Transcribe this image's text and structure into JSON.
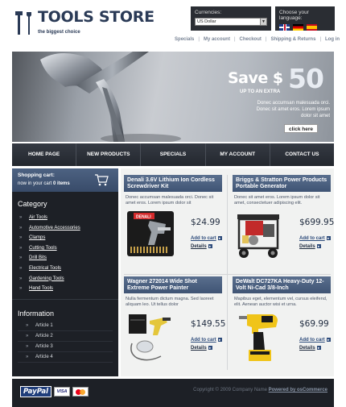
{
  "header": {
    "title": "TOOLS STORE",
    "subtitle": "the biggest choice",
    "currencies_label": "Currencies:",
    "currency_selected": "US Dollar",
    "language_label": "Choose your language:",
    "languages": [
      "English",
      "Deutsch",
      "Español"
    ],
    "toplinks": [
      "Specials",
      "My account",
      "Checkout",
      "Shipping & Returns",
      "Log in"
    ]
  },
  "banner": {
    "save_word": "Save $",
    "save_amount": "50",
    "up_to": "UP TO AN EXTRA",
    "desc": "Donec accumsan malesuada orci. Donec sit amet eros. Lorem ipsum dolor sit amet",
    "button": "click here"
  },
  "nav": [
    "HOME PAGE",
    "NEW PRODUCTS",
    "SPECIALS",
    "MY ACCOUNT",
    "CONTACT US"
  ],
  "cart": {
    "title": "Shopping cart:",
    "line_prefix": "now in your cart ",
    "count": "0 items"
  },
  "category": {
    "heading": "Category",
    "items": [
      "Air Tools",
      "Automotive Accessories",
      "Clamps",
      "Cutting Tools",
      "Drill Bits",
      "Electrical Tools",
      "Gardening Tools",
      "Hand Tools"
    ]
  },
  "information": {
    "heading": "Information",
    "items": [
      "Article 1",
      "Article 2",
      "Article 3",
      "Article 4"
    ]
  },
  "products": [
    {
      "title": "Denali 3.6V Lithium Ion Cordless Screwdriver Kit",
      "desc": "Donec accumsan malesuada orci. Donec sit amet eros. Lorem ipsum dolor sit",
      "price": "$24.99",
      "add": "Add to cart",
      "details": "Details",
      "image": "screwdriver-kit-image"
    },
    {
      "title": "Briggs & Stratton Power Products Portable Generator",
      "desc": "Donec sit amet eros. Lorem ipsum dolor sit amet, consectetuer adipiscing elit.",
      "price": "$699.95",
      "add": "Add to cart",
      "details": "Details",
      "image": "generator-image"
    },
    {
      "title": "Wagner 272014 Wide Shot Extreme Power Painter",
      "desc": "Nulla fermentum dictum magna. Sed laoreet aliquam leo. Ut tellus dolor",
      "price": "$149.55",
      "add": "Add to cart",
      "details": "Details",
      "image": "paint-sprayer-image"
    },
    {
      "title": "DeWalt DC727KA Heavy-Duty 12-Volt Ni-Cad 3/8-Inch",
      "desc": "Mapibus eget, elementum vel, cursus eleifend, elit. Aenean auctor wisi et urna.",
      "price": "$69.99",
      "add": "Add to cart",
      "details": "Details",
      "image": "cordless-drill-image"
    }
  ],
  "footer": {
    "payments": [
      "PayPal",
      "VISA",
      "MasterCard"
    ],
    "copyright": "Copyright © 2009 Company Name",
    "powered": "Powered by osCommerce"
  },
  "colors": {
    "dark": "#1d2026",
    "accent_blue": "#3f5474",
    "link_blue": "#2c4a7a"
  }
}
